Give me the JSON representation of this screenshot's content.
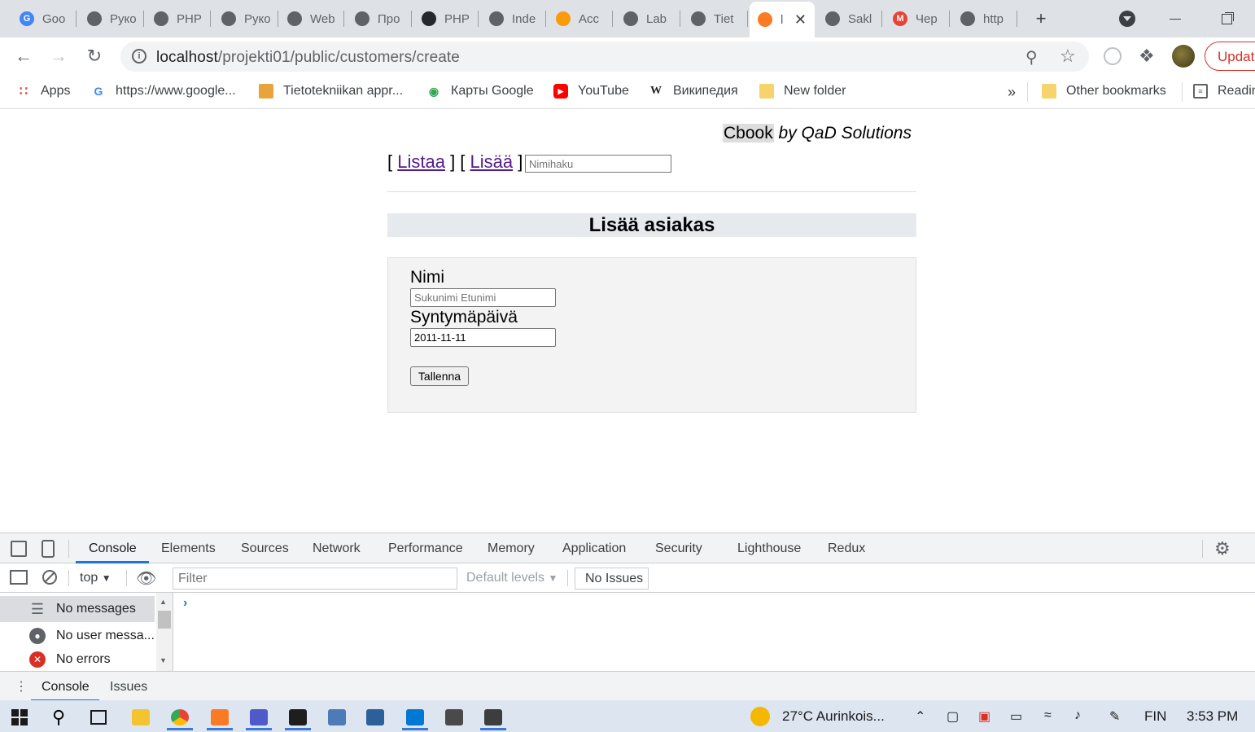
{
  "browser": {
    "tabs": [
      {
        "label": "Goo",
        "icon": "google-translate-icon",
        "color": "#4285f4",
        "glyph": "G"
      },
      {
        "label": "Руко",
        "icon": "globe-icon",
        "color": "#5f6368",
        "glyph": ""
      },
      {
        "label": "PHP",
        "icon": "globe-icon",
        "color": "#5f6368",
        "glyph": ""
      },
      {
        "label": "Руко",
        "icon": "globe-icon",
        "color": "#5f6368",
        "glyph": ""
      },
      {
        "label": "Web",
        "icon": "globe-icon",
        "color": "#5f6368",
        "glyph": ""
      },
      {
        "label": "Про",
        "icon": "globe-icon",
        "color": "#5f6368",
        "glyph": ""
      },
      {
        "label": "PHP",
        "icon": "github-icon",
        "color": "#24292e",
        "glyph": ""
      },
      {
        "label": "Inde",
        "icon": "globe-icon",
        "color": "#5f6368",
        "glyph": ""
      },
      {
        "label": "Acc",
        "icon": "phpmyadmin-icon",
        "color": "#f89c0e",
        "glyph": ""
      },
      {
        "label": "Lab",
        "icon": "globe-icon",
        "color": "#5f6368",
        "glyph": ""
      },
      {
        "label": "Tiet",
        "icon": "globe-icon",
        "color": "#5f6368",
        "glyph": ""
      },
      {
        "label": "l",
        "icon": "xampp-icon",
        "color": "#fb7a24",
        "glyph": "",
        "active": true
      },
      {
        "label": "Sakl",
        "icon": "globe-icon",
        "color": "#5f6368",
        "glyph": ""
      },
      {
        "label": "Чер",
        "icon": "gmail-icon",
        "color": "#ea4335",
        "glyph": "M"
      },
      {
        "label": "http",
        "icon": "globe-icon",
        "color": "#5f6368",
        "glyph": ""
      }
    ],
    "new_tab_label": "+",
    "url_host": "localhost",
    "url_path": "/projekti01/public/customers/create",
    "update_label": "Update",
    "bookmarks": [
      {
        "label": "Apps",
        "icon": "apps-grid-icon"
      },
      {
        "label": "https://www.google...",
        "icon": "google-icon"
      },
      {
        "label": "Tietotekniikan appr...",
        "icon": "bookmark-site-icon"
      },
      {
        "label": "Карты Google",
        "icon": "google-maps-icon"
      },
      {
        "label": "YouTube",
        "icon": "youtube-icon"
      },
      {
        "label": "Википедия",
        "icon": "wikipedia-icon"
      },
      {
        "label": "New folder",
        "icon": "folder-icon"
      }
    ],
    "bookmarks_overflow": "»",
    "other_bookmarks": "Other bookmarks",
    "reading_list": "Reading list"
  },
  "page": {
    "brand_name": "Cbook",
    "brand_by": " by QaD Solutions",
    "nav_list": "Listaa",
    "nav_add": "Lisää",
    "search_placeholder": "Nimihaku",
    "form_title": "Lisää asiakas",
    "name_label": "Nimi",
    "name_placeholder": "Sukunimi Etunimi",
    "birthday_label": "Syntymäpäivä",
    "birthday_value": "2011-11-11",
    "save_label": "Tallenna"
  },
  "devtools": {
    "tabs": [
      "Console",
      "Elements",
      "Sources",
      "Network",
      "Performance",
      "Memory",
      "Application",
      "Security",
      "Lighthouse",
      "Redux"
    ],
    "context": "top",
    "filter_placeholder": "Filter",
    "levels": "Default levels",
    "issues": "No Issues",
    "sidebar": [
      "No messages",
      "No user messa...",
      "No errors"
    ],
    "prompt": "›",
    "drawer_tabs": [
      "Console",
      "Issues"
    ]
  },
  "taskbar": {
    "weather": "27°C  Aurinkois...",
    "language": "FIN",
    "time": "3:53 PM"
  }
}
